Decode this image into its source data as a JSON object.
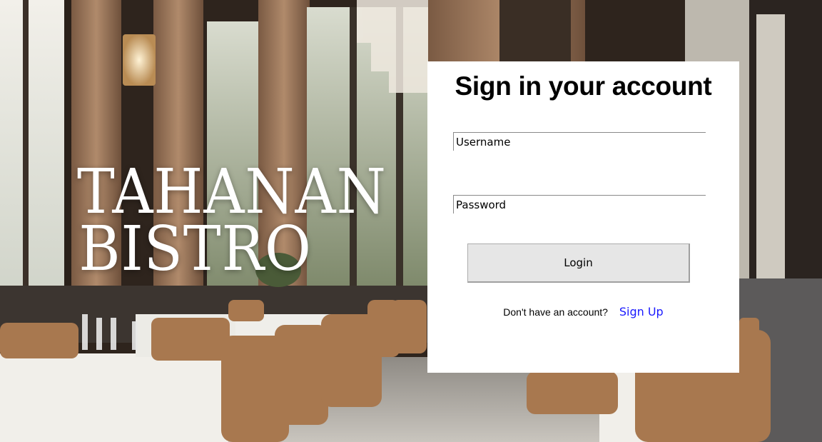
{
  "brand": {
    "line1": "TAHANAN",
    "line2": "BISTRO"
  },
  "login": {
    "title": "Sign in your account",
    "username_placeholder": "Username",
    "password_placeholder": "Password",
    "username_value": "",
    "password_value": "",
    "login_label": "Login",
    "signup_prompt": "Don't have an account?",
    "signup_link": "Sign Up"
  },
  "colors": {
    "card_background": "#ffffff",
    "link": "#1a1aff",
    "button_background": "#e6e6e6"
  }
}
